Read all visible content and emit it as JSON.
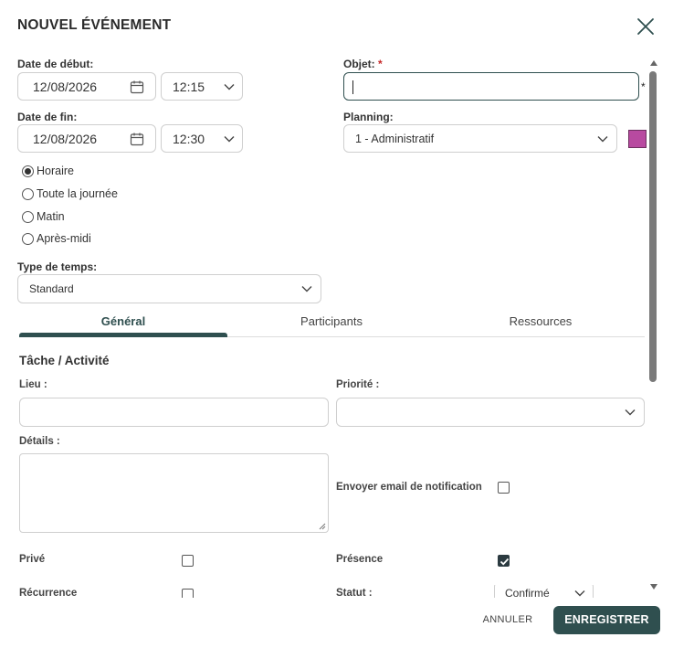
{
  "dialog": {
    "title": "NOUVEL ÉVÉNEMENT",
    "close_icon": "close-icon"
  },
  "start": {
    "label": "Date de début:",
    "date": "12/08/2026",
    "time": "12:15"
  },
  "end": {
    "label": "Date de fin:",
    "date": "12/08/2026",
    "time": "12:30"
  },
  "objet": {
    "label": "Objet:",
    "required_mark": "*",
    "value": "",
    "after_mark": "*"
  },
  "planning": {
    "label": "Planning:",
    "value": "1 - Administratif",
    "color": "#b84aa0"
  },
  "time_mode": {
    "options": [
      "Horaire",
      "Toute la journée",
      "Matin",
      "Après-midi"
    ],
    "selected": "Horaire"
  },
  "type_temps": {
    "label": "Type de temps:",
    "value": "Standard"
  },
  "tabs": [
    {
      "label": "Général",
      "active": true
    },
    {
      "label": "Participants",
      "active": false
    },
    {
      "label": "Ressources",
      "active": false
    }
  ],
  "general": {
    "section_title": "Tâche / Activité",
    "lieu_label": "Lieu :",
    "lieu_value": "",
    "priorite_label": "Priorité :",
    "priorite_value": "",
    "details_label": "Détails :",
    "details_value": "",
    "email_label": "Envoyer email de notification",
    "email_checked": false,
    "prive_label": "Privé",
    "prive_checked": false,
    "presence_label": "Présence",
    "presence_checked": true,
    "recurrence_label": "Récurrence",
    "recurrence_checked": false,
    "statut_label": "Statut :",
    "statut_value": "Confirmé"
  },
  "footer": {
    "cancel_label": "ANNULER",
    "save_label": "ENREGISTRER"
  },
  "colors": {
    "accent": "#2f4f4f",
    "required": "#c62828",
    "planning_swatch": "#b84aa0"
  }
}
